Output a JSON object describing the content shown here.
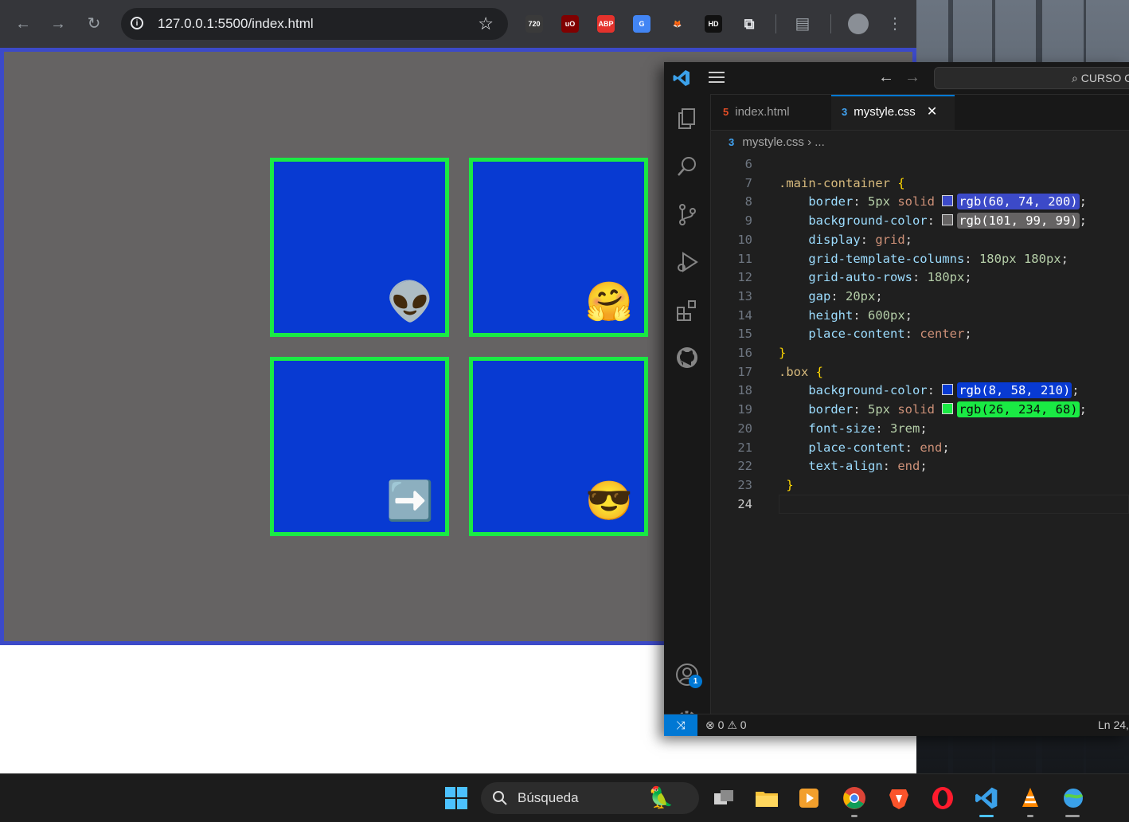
{
  "browser": {
    "url": "127.0.0.1:5500/index.html",
    "extensions": [
      {
        "name": "720-extension-icon",
        "label": "720",
        "color": "#3a3a3a"
      },
      {
        "name": "ublock-icon",
        "label": "uO",
        "color": "#800000"
      },
      {
        "name": "adblock-plus-icon",
        "label": "ABP",
        "color": "#e4322c"
      },
      {
        "name": "google-translate-icon",
        "label": "G",
        "color": "#4285f4"
      },
      {
        "name": "extension-fox-icon",
        "label": "🦊",
        "color": "transparent"
      },
      {
        "name": "hd-extension-icon",
        "label": "HD",
        "color": "#111111"
      }
    ]
  },
  "page": {
    "colors": {
      "container_border": "#3c4ac8",
      "container_bg": "#656363",
      "box_bg": "#083ad2",
      "box_border": "#1aea44"
    },
    "boxes": [
      {
        "emoji": "👽",
        "icon": "alien-emoji"
      },
      {
        "emoji": "🤗",
        "icon": "hugging-face-emoji"
      },
      {
        "emoji": "➡️",
        "icon": "right-arrow-emoji"
      },
      {
        "emoji": "😎",
        "icon": "sunglasses-face-emoji"
      }
    ]
  },
  "vscode": {
    "search_label": "CURSO CS",
    "tabs": [
      {
        "label": "index.html",
        "icon": "html5-icon",
        "active": false
      },
      {
        "label": "mystyle.css",
        "icon": "css3-icon",
        "active": true
      }
    ],
    "breadcrumb": {
      "file": "mystyle.css",
      "separator": "›",
      "rest": "..."
    },
    "code_lines": [
      {
        "n": "6",
        "tokens": []
      },
      {
        "n": "7",
        "tokens": [
          {
            "c": "sel",
            "t": ".main-container "
          },
          {
            "c": "brace",
            "t": "{"
          }
        ]
      },
      {
        "n": "8",
        "tokens": [
          {
            "c": "prop",
            "t": "    border"
          },
          {
            "c": "pun",
            "t": ": "
          },
          {
            "c": "num",
            "t": "5px"
          },
          {
            "c": "val",
            "t": " solid "
          },
          {
            "c": "swatch",
            "color": "rgb(60,74,200)"
          },
          {
            "c": "rgb",
            "t": "rgb(60, 74, 200)",
            "bg": "#3c4ac8"
          },
          {
            "c": "pun",
            "t": ";"
          }
        ]
      },
      {
        "n": "9",
        "tokens": [
          {
            "c": "prop",
            "t": "    background-color"
          },
          {
            "c": "pun",
            "t": ": "
          },
          {
            "c": "swatch",
            "color": "rgb(101,99,99)"
          },
          {
            "c": "rgb",
            "t": "rgb(101, 99, 99)",
            "bg": "#656363"
          },
          {
            "c": "pun",
            "t": ";"
          }
        ]
      },
      {
        "n": "10",
        "tokens": [
          {
            "c": "prop",
            "t": "    display"
          },
          {
            "c": "pun",
            "t": ": "
          },
          {
            "c": "val",
            "t": "grid"
          },
          {
            "c": "pun",
            "t": ";"
          }
        ]
      },
      {
        "n": "11",
        "tokens": [
          {
            "c": "prop",
            "t": "    grid-template-columns"
          },
          {
            "c": "pun",
            "t": ": "
          },
          {
            "c": "num",
            "t": "180px 180px"
          },
          {
            "c": "pun",
            "t": ";"
          }
        ]
      },
      {
        "n": "12",
        "tokens": [
          {
            "c": "prop",
            "t": "    grid-auto-rows"
          },
          {
            "c": "pun",
            "t": ": "
          },
          {
            "c": "num",
            "t": "180px"
          },
          {
            "c": "pun",
            "t": ";"
          }
        ]
      },
      {
        "n": "13",
        "tokens": [
          {
            "c": "prop",
            "t": "    gap"
          },
          {
            "c": "pun",
            "t": ": "
          },
          {
            "c": "num",
            "t": "20px"
          },
          {
            "c": "pun",
            "t": ";"
          }
        ]
      },
      {
        "n": "14",
        "tokens": [
          {
            "c": "prop",
            "t": "    height"
          },
          {
            "c": "pun",
            "t": ": "
          },
          {
            "c": "num",
            "t": "600px"
          },
          {
            "c": "pun",
            "t": ";"
          }
        ]
      },
      {
        "n": "15",
        "tokens": [
          {
            "c": "prop",
            "t": "    place-content"
          },
          {
            "c": "pun",
            "t": ": "
          },
          {
            "c": "val",
            "t": "center"
          },
          {
            "c": "pun",
            "t": ";"
          }
        ]
      },
      {
        "n": "16",
        "tokens": [
          {
            "c": "brace",
            "t": "}"
          }
        ]
      },
      {
        "n": "17",
        "tokens": [
          {
            "c": "sel",
            "t": ".box "
          },
          {
            "c": "brace",
            "t": "{"
          }
        ]
      },
      {
        "n": "18",
        "tokens": [
          {
            "c": "prop",
            "t": "    background-color"
          },
          {
            "c": "pun",
            "t": ": "
          },
          {
            "c": "swatch",
            "color": "rgb(8,58,210)"
          },
          {
            "c": "rgb",
            "t": "rgb(8, 58, 210)",
            "bg": "#083ad2"
          },
          {
            "c": "pun",
            "t": ";"
          }
        ]
      },
      {
        "n": "19",
        "tokens": [
          {
            "c": "prop",
            "t": "    border"
          },
          {
            "c": "pun",
            "t": ": "
          },
          {
            "c": "num",
            "t": "5px"
          },
          {
            "c": "val",
            "t": " solid "
          },
          {
            "c": "swatch",
            "color": "rgb(26,234,68)"
          },
          {
            "c": "rgb",
            "t": "rgb(26, 234, 68)",
            "bg": "#1aea44",
            "dark": true
          },
          {
            "c": "pun",
            "t": ";"
          }
        ]
      },
      {
        "n": "20",
        "tokens": [
          {
            "c": "prop",
            "t": "    font-size"
          },
          {
            "c": "pun",
            "t": ": "
          },
          {
            "c": "num",
            "t": "3rem"
          },
          {
            "c": "pun",
            "t": ";"
          }
        ]
      },
      {
        "n": "21",
        "tokens": [
          {
            "c": "prop",
            "t": "    place-content"
          },
          {
            "c": "pun",
            "t": ": "
          },
          {
            "c": "val",
            "t": "end"
          },
          {
            "c": "pun",
            "t": ";"
          }
        ]
      },
      {
        "n": "22",
        "tokens": [
          {
            "c": "prop",
            "t": "    text-align"
          },
          {
            "c": "pun",
            "t": ": "
          },
          {
            "c": "val",
            "t": "end"
          },
          {
            "c": "pun",
            "t": ";"
          }
        ]
      },
      {
        "n": "23",
        "tokens": [
          {
            "c": "brace",
            "t": " }"
          }
        ]
      },
      {
        "n": "24",
        "tokens": [],
        "current": true
      }
    ],
    "accounts_badge": "1",
    "status": {
      "errors": "0",
      "warnings": "0",
      "position": "Ln 24,"
    }
  },
  "taskbar": {
    "search_label": "Búsqueda"
  }
}
